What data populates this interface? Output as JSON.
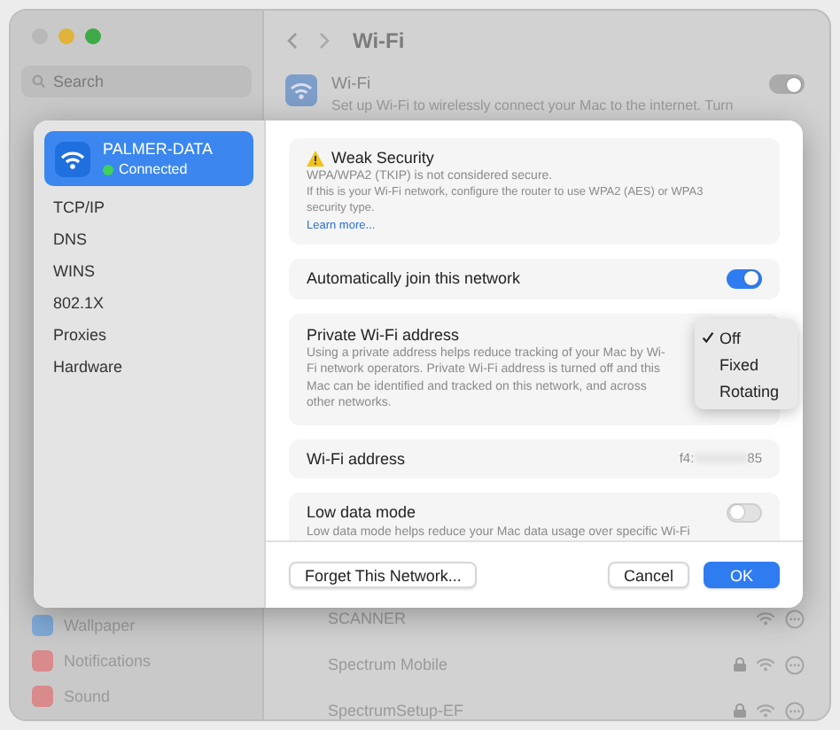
{
  "window": {
    "title": "Wi-Fi",
    "search": {
      "placeholder": "Search"
    }
  },
  "sidebar": {
    "items": [
      {
        "label": "Wallpaper",
        "color": "#7fa9d6"
      },
      {
        "label": "Notifications",
        "color": "#d98a8a"
      },
      {
        "label": "Sound",
        "color": "#d98a8a"
      }
    ]
  },
  "wifi": {
    "title": "Wi-Fi",
    "description": "Set up Wi-Fi to wirelessly connect your Mac to the internet. Turn",
    "on": true
  },
  "networks": [
    {
      "name": "SCANNER",
      "locked": false
    },
    {
      "name": "Spectrum Mobile",
      "locked": true
    },
    {
      "name": "SpectrumSetup-EF",
      "locked": true
    }
  ],
  "dialog": {
    "sidebar": [
      {
        "kind": "network",
        "label": "PALMER-DATA",
        "status": "Connected",
        "selected": true
      },
      {
        "kind": "tab",
        "label": "TCP/IP",
        "selected": false
      },
      {
        "kind": "tab",
        "label": "DNS",
        "selected": false
      },
      {
        "kind": "tab",
        "label": "WINS",
        "selected": false
      },
      {
        "kind": "tab",
        "label": "802.1X",
        "selected": false
      },
      {
        "kind": "tab",
        "label": "Proxies",
        "selected": false
      },
      {
        "kind": "tab",
        "label": "Hardware",
        "selected": false
      }
    ],
    "warning": {
      "title": "Weak Security",
      "message": "WPA/WPA2 (TKIP) is not considered secure.",
      "detail": "If this is your Wi-Fi network, configure the router to use WPA2 (AES) or WPA3 security type.",
      "link": "Learn more..."
    },
    "auto_join": {
      "label": "Automatically join this network",
      "on": true
    },
    "private_address": {
      "label": "Private Wi-Fi address",
      "description": "Using a private address helps reduce tracking of your Mac by Wi-Fi network operators. Private Wi-Fi address is turned off and this Mac can be identified and tracked on this network, and across other networks.",
      "options": [
        {
          "label": "Off",
          "selected": true
        },
        {
          "label": "Fixed",
          "selected": false
        },
        {
          "label": "Rotating",
          "selected": false
        }
      ]
    },
    "wifi_address": {
      "label": "Wi-Fi address",
      "value_start": "f4:",
      "value_end": "85"
    },
    "low_data": {
      "label": "Low data mode",
      "description": "Low data mode helps reduce your Mac data usage over specific Wi-Fi",
      "on": false
    },
    "buttons": {
      "forget": "Forget This Network...",
      "cancel": "Cancel",
      "ok": "OK"
    }
  }
}
